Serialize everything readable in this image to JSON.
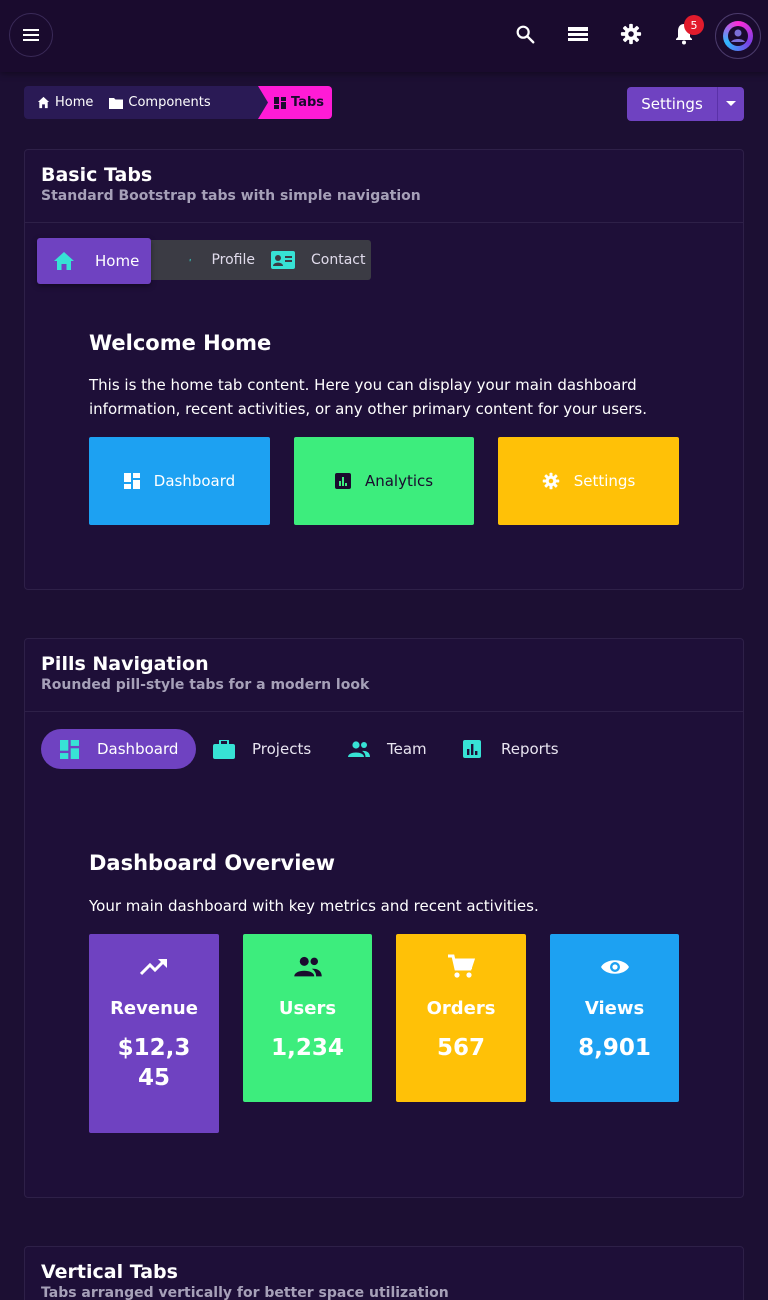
{
  "topbar": {
    "icons": [
      "menu-icon",
      "search-icon",
      "list-icon",
      "gear-icon",
      "bell-icon"
    ],
    "notification_count": "5"
  },
  "breadcrumb": {
    "items": [
      {
        "label": "Home",
        "icon": "home-icon"
      },
      {
        "label": "Components",
        "icon": "folder-icon"
      },
      {
        "label": "Tabs",
        "icon": "dashboard-icon"
      }
    ]
  },
  "settings_button": {
    "label": "Settings"
  },
  "basic_tabs": {
    "title": "Basic Tabs",
    "subtitle": "Standard Bootstrap tabs with simple navigation",
    "tabs": [
      {
        "label": "Home",
        "icon": "home-icon",
        "active": true
      },
      {
        "label": "Profile",
        "icon": "person-icon"
      },
      {
        "label": "Contact",
        "icon": "contact-card-icon"
      }
    ],
    "pane": {
      "title": "Welcome Home",
      "text": "This is the home tab content. Here you can display your main dashboard information, recent activities, or any other primary content for your users.",
      "buttons": [
        {
          "label": "Dashboard",
          "icon": "dashboard-icon",
          "color": "#1da1f2"
        },
        {
          "label": "Analytics",
          "icon": "analytics-icon",
          "color": "#3ded7d"
        },
        {
          "label": "Settings",
          "icon": "gear-icon",
          "color": "#ffc107"
        }
      ]
    }
  },
  "pills": {
    "title": "Pills Navigation",
    "subtitle": "Rounded pill-style tabs for a modern look",
    "tabs": [
      {
        "label": "Dashboard",
        "icon": "dashboard-icon",
        "active": true
      },
      {
        "label": "Projects",
        "icon": "briefcase-icon"
      },
      {
        "label": "Team",
        "icon": "people-icon"
      },
      {
        "label": "Reports",
        "icon": "bar-chart-icon"
      }
    ],
    "pane": {
      "title": "Dashboard Overview",
      "text": "Your main dashboard with key metrics and recent activities.",
      "stats": [
        {
          "label": "Revenue",
          "value": "$12,345",
          "icon": "trending-up-icon",
          "color": "#6f42c1"
        },
        {
          "label": "Users",
          "value": "1,234",
          "icon": "people-icon",
          "color": "#3ded7d"
        },
        {
          "label": "Orders",
          "value": "567",
          "icon": "cart-icon",
          "color": "#ffc107"
        },
        {
          "label": "Views",
          "value": "8,901",
          "icon": "eye-icon",
          "color": "#1da1f2"
        }
      ]
    }
  },
  "vertical_tabs": {
    "title": "Vertical Tabs",
    "subtitle": "Tabs arranged vertically for better space utilization"
  },
  "colors": {
    "accent": "#6f42c1",
    "teal": "#37e2d5",
    "magenta": "#ff1bd6",
    "background": "#1c0f33"
  }
}
